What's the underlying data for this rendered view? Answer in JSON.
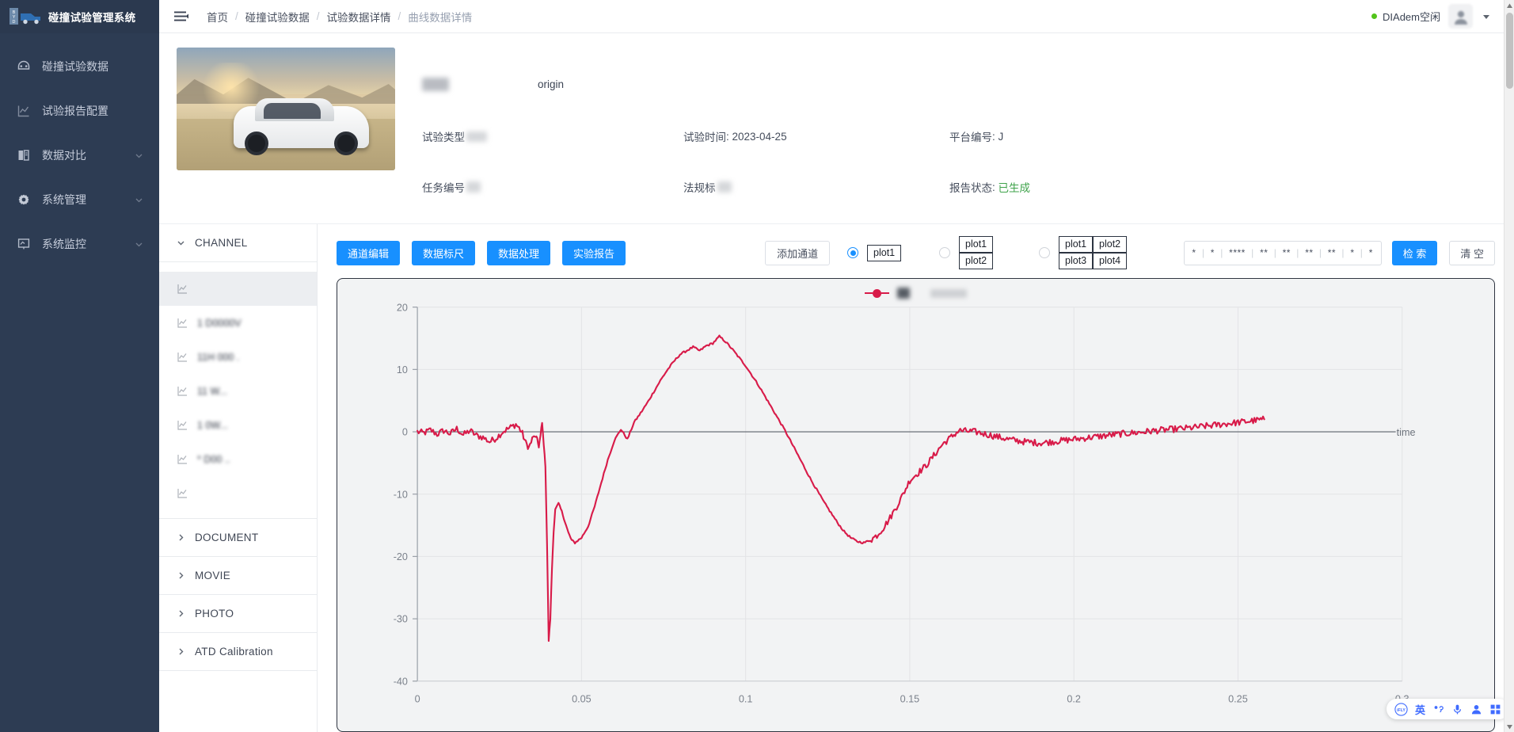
{
  "brand": {
    "title": "碰撞试验管理系统",
    "logo_icon": "truck-logo-icon"
  },
  "sidebar": {
    "items": [
      {
        "label": "碰撞试验数据",
        "icon": "crash-data-icon",
        "expandable": false
      },
      {
        "label": "试验报告配置",
        "icon": "report-chart-icon",
        "expandable": false
      },
      {
        "label": "数据对比",
        "icon": "compare-book-icon",
        "expandable": true
      },
      {
        "label": "系统管理",
        "icon": "gear-icon",
        "expandable": true
      },
      {
        "label": "系统监控",
        "icon": "monitor-icon",
        "expandable": true
      }
    ]
  },
  "header": {
    "menu_icon": "hamburger-icon",
    "breadcrumbs": [
      {
        "label": "首页",
        "current": false
      },
      {
        "label": "碰撞试验数据",
        "current": false
      },
      {
        "label": "试验数据详情",
        "current": false
      },
      {
        "label": "曲线数据详情",
        "current": true
      }
    ],
    "separator": "/",
    "status_label": "DIAdem空闲",
    "status_color": "#52c41a",
    "avatar_icon": "user-avatar",
    "dropdown_icon": "chevron-down-icon"
  },
  "info": {
    "thumbnail_alt": "test-vehicle-photo",
    "title_redacted": "",
    "origin_label": "origin",
    "fields": [
      {
        "label": "试验类型",
        "value": "",
        "redacted": true
      },
      {
        "label": "试验时间",
        "value": "2023-04-25",
        "redacted": false
      },
      {
        "label": "平台编号",
        "value": "J",
        "redacted": false
      },
      {
        "label": "任务编号",
        "value": "",
        "redacted": true
      },
      {
        "label": "法规标",
        "value": "",
        "redacted": true
      },
      {
        "label": "报告状态",
        "value": "已生成",
        "redacted": false,
        "value_color": "#3fa34b"
      }
    ]
  },
  "tree": {
    "channel_section": {
      "label": "CHANNEL",
      "expanded": true,
      "icon": "chevron-down-icon"
    },
    "channels": [
      {
        "label": "",
        "selected": true
      },
      {
        "label": "1        D0000V",
        "selected": false
      },
      {
        "label": "11H      000    .",
        "selected": false
      },
      {
        "label": "11            W...",
        "selected": false
      },
      {
        "label": "1             0W...",
        "selected": false
      },
      {
        "label": "*     D00     ..",
        "selected": false
      },
      {
        "label": "",
        "selected": false
      }
    ],
    "sections": [
      {
        "label": "DOCUMENT",
        "expanded": false,
        "icon": "chevron-right-icon"
      },
      {
        "label": "MOVIE",
        "expanded": false,
        "icon": "chevron-right-icon"
      },
      {
        "label": "PHOTO",
        "expanded": false,
        "icon": "chevron-right-icon"
      },
      {
        "label": "ATD Calibration",
        "expanded": false,
        "icon": "chevron-right-icon"
      }
    ]
  },
  "toolbar": {
    "buttons": [
      {
        "label": "通道编辑",
        "style": "primary"
      },
      {
        "label": "数据标尺",
        "style": "primary"
      },
      {
        "label": "数据处理",
        "style": "primary"
      },
      {
        "label": "实验报告",
        "style": "primary"
      }
    ],
    "add_channel_label": "添加通道",
    "layouts": [
      {
        "selected": true,
        "cells": [
          [
            "plot1"
          ]
        ]
      },
      {
        "selected": false,
        "cells": [
          [
            "plot1"
          ],
          [
            "plot2"
          ]
        ]
      },
      {
        "selected": false,
        "cells": [
          [
            "plot1",
            "plot2"
          ],
          [
            "plot3",
            "plot4"
          ]
        ]
      }
    ],
    "search_value": "*  |  *  |  ****  |  **  |  **  |  **  |  **  |  *  |  *",
    "search_tokens": [
      "*",
      "*",
      "****",
      "**",
      "**",
      "**",
      "**",
      "*",
      "*"
    ],
    "search_button": "检 索",
    "clear_button": "清 空"
  },
  "chart_data": {
    "type": "line",
    "title": "",
    "xlabel": "time",
    "ylabel": "",
    "xlim": [
      0,
      0.3
    ],
    "ylim": [
      -40,
      20
    ],
    "xticks": [
      "0",
      "0.05",
      "0.1",
      "0.15",
      "0.2",
      "0.25",
      "0.3"
    ],
    "xtick_values": [
      0,
      0.05,
      0.1,
      0.15,
      0.2,
      0.25,
      0.3
    ],
    "yticks": [
      "20",
      "10",
      "0",
      "-10",
      "-20",
      "-30",
      "-40"
    ],
    "ytick_values": [
      20,
      10,
      0,
      -10,
      -20,
      -30,
      -40
    ],
    "grid": true,
    "legend_position": "top-center",
    "series": [
      {
        "name": "channel-1",
        "color": "#d81b49",
        "x": [
          0.0,
          0.002,
          0.004,
          0.006,
          0.008,
          0.01,
          0.012,
          0.014,
          0.016,
          0.018,
          0.02,
          0.022,
          0.024,
          0.026,
          0.028,
          0.03,
          0.031,
          0.032,
          0.033,
          0.034,
          0.035,
          0.036,
          0.0365,
          0.037,
          0.0375,
          0.038,
          0.0385,
          0.039,
          0.0395,
          0.04,
          0.0405,
          0.041,
          0.0415,
          0.042,
          0.043,
          0.044,
          0.045,
          0.046,
          0.047,
          0.048,
          0.05,
          0.052,
          0.054,
          0.056,
          0.058,
          0.06,
          0.062,
          0.064,
          0.066,
          0.068,
          0.07,
          0.072,
          0.074,
          0.076,
          0.078,
          0.08,
          0.082,
          0.084,
          0.086,
          0.088,
          0.09,
          0.092,
          0.094,
          0.096,
          0.098,
          0.1,
          0.102,
          0.104,
          0.106,
          0.108,
          0.11,
          0.112,
          0.114,
          0.116,
          0.118,
          0.12,
          0.122,
          0.124,
          0.126,
          0.128,
          0.13,
          0.132,
          0.134,
          0.136,
          0.138,
          0.14,
          0.142,
          0.144,
          0.146,
          0.148,
          0.15,
          0.155,
          0.16,
          0.165,
          0.17,
          0.175,
          0.18,
          0.185,
          0.19,
          0.195,
          0.2,
          0.205,
          0.21,
          0.215,
          0.22,
          0.225,
          0.23,
          0.235,
          0.24,
          0.245,
          0.25,
          0.255,
          0.258
        ],
        "y": [
          0.0,
          -0.2,
          0.3,
          -0.4,
          0.2,
          -0.3,
          0.5,
          -0.5,
          0.2,
          -0.6,
          -0.9,
          -1.6,
          -1.0,
          0.0,
          0.6,
          1.2,
          0.6,
          -0.3,
          -1.8,
          -2.5,
          -1.2,
          -0.6,
          -1.5,
          -2.2,
          -0.8,
          1.4,
          -2.0,
          -5.5,
          -18.0,
          -33.5,
          -30.0,
          -22.0,
          -16.0,
          -12.5,
          -11.5,
          -12.8,
          -14.5,
          -16.2,
          -17.4,
          -17.8,
          -17.0,
          -15.2,
          -12.0,
          -8.2,
          -4.5,
          -1.4,
          0.4,
          -1.2,
          1.5,
          3.0,
          4.6,
          6.4,
          8.2,
          9.8,
          11.2,
          12.4,
          13.0,
          13.6,
          13.0,
          13.8,
          14.2,
          15.3,
          14.4,
          13.2,
          11.9,
          10.6,
          9.0,
          7.4,
          5.6,
          3.8,
          2.0,
          0.2,
          -1.8,
          -3.8,
          -5.8,
          -7.8,
          -9.6,
          -11.4,
          -13.0,
          -14.6,
          -16.0,
          -17.0,
          -17.6,
          -17.8,
          -17.4,
          -16.6,
          -15.4,
          -13.8,
          -12.0,
          -10.0,
          -7.8,
          -5.4,
          -2.0,
          0.2,
          0.0,
          -0.6,
          -1.2,
          -1.6,
          -1.8,
          -1.5,
          -1.2,
          -0.9,
          -0.6,
          -0.3,
          -0.1,
          0.2,
          0.4,
          0.6,
          0.9,
          1.2,
          1.5,
          1.8,
          2.0,
          2.2,
          2.3
        ]
      }
    ]
  },
  "ime": {
    "logo": "iFLY",
    "lang_label": "英",
    "icons": [
      "punctuation-icon",
      "microphone-icon",
      "person-icon",
      "apps-grid-icon"
    ]
  }
}
